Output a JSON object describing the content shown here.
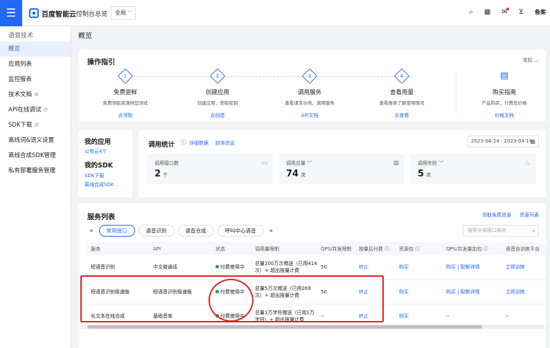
{
  "topbar": {
    "logo_text": "百度智能云",
    "console": "控制台总览",
    "region": "全局",
    "last_label": "备案"
  },
  "sidebar": {
    "title": "语音技术",
    "items": [
      {
        "label": "概览",
        "active": true
      },
      {
        "label": "应用列表"
      },
      {
        "label": "监控报表"
      },
      {
        "label": "技术文档"
      },
      {
        "label": "API在线调试"
      },
      {
        "label": "SDK下载"
      },
      {
        "label": "离线词&语义设置"
      },
      {
        "label": "离线合成SDK管理"
      },
      {
        "label": "私有部署服务管理"
      }
    ]
  },
  "page": {
    "title": "概览"
  },
  "guide": {
    "title": "操作指引",
    "collapse": "收起",
    "steps": [
      {
        "num": "1",
        "title": "免费尝鲜",
        "desc": "免费领取资源供您测试",
        "link": "去领取"
      },
      {
        "num": "2",
        "title": "创建应用",
        "desc": "创建应用，获取密钥",
        "link": "去创建"
      },
      {
        "num": "3",
        "title": "调用服务",
        "desc": "查看请求示例，调用服务",
        "link": "API文档"
      },
      {
        "num": "4",
        "title": "查看用量",
        "desc": "查看报表了解使用情况",
        "link": "去查看"
      }
    ],
    "buy": {
      "title": "购买指南",
      "desc": "产品购买，计费及价格",
      "link": "价格文档"
    }
  },
  "myapp": {
    "title": "我的应用",
    "link": "公有云4个",
    "sdk_title": "我的SDK",
    "sdk_links": [
      "SDK下载",
      "离线合成SDK"
    ]
  },
  "stats": {
    "title": "调用统计",
    "tabs": [
      "详细数据",
      "财务信息"
    ],
    "date_range": "2023-04-14 - 2023-04-14",
    "boxes": [
      {
        "label": "调用接口数",
        "value": "2",
        "unit": "个"
      },
      {
        "label": "调用总量",
        "value": "74",
        "unit": "次"
      },
      {
        "label": "调用失败",
        "value": "5",
        "unit": "次"
      }
    ]
  },
  "services": {
    "title": "服务列表",
    "links": [
      "领取免费资源",
      "资源列表"
    ],
    "tabs": [
      "常用接口",
      "语音识别",
      "语音合成",
      "呼叫中心语音"
    ],
    "search_placeholder": "搜索全部接口服务",
    "columns": [
      "服务",
      "API",
      "状态",
      "调用量限制",
      "QPS/并发限制",
      "按量后付费",
      "资源包",
      "QPS/并发量加包",
      "语音自训练平台"
    ],
    "rows": [
      {
        "service": "短语音识别",
        "api": "中文普通话",
        "status": "付费使用中",
        "limit": "总量200万次赠送（已用414次）+ 超出按量计费",
        "qps": "50",
        "postpay": "终止",
        "pkg": "购买",
        "qps_pkg": "购买 | 配额详情",
        "train": "立即训练"
      },
      {
        "service": "短语音识别极速版",
        "api": "短语音识别极速版",
        "status": "付费使用中",
        "limit": "总量5万次赠送（已用269次）+ 超出按量计费",
        "qps": "50",
        "postpay": "终止",
        "pkg": "购买",
        "qps_pkg": "购买 | 配额详情",
        "train": "立即训练"
      },
      {
        "service": "长文本在线合成",
        "api": "基础音库",
        "status": "付费使用中",
        "limit": "总量1万字符赠送（已用1万字符）+ 超出按量计费",
        "qps": "--",
        "postpay": "终止",
        "pkg": "购买",
        "qps_pkg": "--",
        "train": "--"
      }
    ]
  },
  "colors": {
    "accent": "#2468f2",
    "status_green": "#1aa34a",
    "highlight_red": "#e02020"
  }
}
